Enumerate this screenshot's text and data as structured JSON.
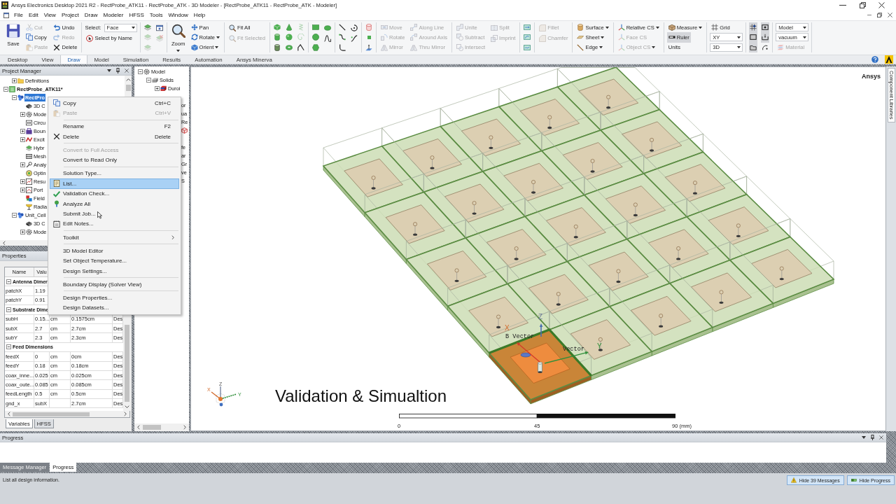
{
  "window": {
    "title": "Ansys Electronics Desktop 2021 R2 - RectProbe_ATK11 - RectProbe_ATK - 3D Modeler - [RectProbe_ATK11 - RectProbe_ATK - Modeler]"
  },
  "menu_bar": [
    "File",
    "Edit",
    "View",
    "Project",
    "Draw",
    "Modeler",
    "HFSS",
    "Tools",
    "Window",
    "Help"
  ],
  "ribbon": {
    "groups": [
      {
        "columns": [
          [
            {
              "kind": "save",
              "label": "Save",
              "disabled": false
            }
          ],
          [
            {
              "kind": "cut",
              "label": "Cut",
              "disabled": true
            },
            {
              "kind": "copy",
              "label": "Copy",
              "disabled": false
            },
            {
              "kind": "paste",
              "label": "Paste",
              "disabled": true
            }
          ],
          [
            {
              "kind": "undo",
              "label": "Undo",
              "disabled": false
            },
            {
              "kind": "redo",
              "label": "Redo",
              "disabled": true
            },
            {
              "kind": "delete",
              "label": "Delete",
              "disabled": false
            }
          ]
        ]
      },
      {
        "columns": [
          [
            {
              "kind": "select",
              "label": "Select:",
              "value": "Face"
            },
            {
              "kind": "select_by_name",
              "label": "Select by Name",
              "disabled": false
            }
          ]
        ]
      },
      {
        "columns": [
          [
            {
              "kind": "sheets",
              "disabled": false
            },
            {
              "kind": "sheets",
              "disabled": true
            },
            {
              "kind": "sheets",
              "disabled": true
            }
          ],
          [
            {
              "kind": "window",
              "disabled": false
            },
            {
              "kind": "sheetx",
              "disabled": true
            }
          ]
        ]
      },
      {
        "columns": [
          [
            {
              "kind": "zoom",
              "label": "Zoom",
              "disabled": false,
              "dropdown": true
            }
          ],
          [
            {
              "kind": "pan",
              "label": "Pan",
              "disabled": false
            },
            {
              "kind": "rotate",
              "label": "Rotate",
              "disabled": false,
              "dropdown": true
            },
            {
              "kind": "orient",
              "label": "Orient",
              "disabled": false,
              "dropdown": true
            }
          ]
        ]
      },
      {
        "columns": [
          [
            {
              "kind": "fit_all",
              "label": "Fit All",
              "disabled": false
            },
            {
              "kind": "fit_selected",
              "label": "Fit Selected",
              "disabled": true
            }
          ]
        ]
      },
      {
        "columns": [
          [
            {
              "kind": "box",
              "disabled": false
            },
            {
              "kind": "cylinder",
              "disabled": false
            },
            {
              "kind": "prism",
              "disabled": false
            }
          ],
          [
            {
              "kind": "cone",
              "disabled": false
            },
            {
              "kind": "sphere",
              "disabled": false
            },
            {
              "kind": "torus",
              "disabled": false
            }
          ],
          [
            {
              "kind": "helix",
              "disabled": true
            },
            {
              "kind": "spiral",
              "disabled": true
            },
            {
              "kind": "bondwire",
              "disabled": false
            }
          ]
        ]
      },
      {
        "columns": [
          [
            {
              "kind": "rectangle",
              "disabled": false
            },
            {
              "kind": "circle",
              "disabled": false
            },
            {
              "kind": "polygon",
              "disabled": false
            }
          ],
          [
            {
              "kind": "ellipse",
              "disabled": false
            },
            {
              "kind": "curved_sheet",
              "disabled": false
            }
          ]
        ]
      },
      {
        "columns": [
          [
            {
              "kind": "line",
              "disabled": false
            },
            {
              "kind": "spline",
              "disabled": false
            },
            {
              "kind": "arc",
              "disabled": false
            }
          ],
          [
            {
              "kind": "center_arc",
              "disabled": false
            },
            {
              "kind": "equation",
              "disabled": false
            }
          ]
        ]
      },
      {
        "columns": [
          [
            {
              "kind": "udp",
              "disabled": false
            },
            {
              "kind": "point",
              "disabled": false
            },
            {
              "kind": "plane",
              "disabled": false
            }
          ]
        ]
      },
      {
        "columns": [
          [
            {
              "kind": "move",
              "label": "Move",
              "disabled": true
            },
            {
              "kind": "rotate_copy",
              "label": "Rotate",
              "disabled": true
            },
            {
              "kind": "mirror",
              "label": "Mirror",
              "disabled": true
            }
          ],
          [
            {
              "kind": "along_line",
              "label": "Along Line",
              "disabled": true
            },
            {
              "kind": "around_axis",
              "label": "Around Axis",
              "disabled": true
            },
            {
              "kind": "thru_mirror",
              "label": "Thru Mirror",
              "disabled": true
            }
          ]
        ]
      },
      {
        "columns": [
          [
            {
              "kind": "unite",
              "label": "Unite",
              "disabled": true
            },
            {
              "kind": "subtract",
              "label": "Subtract",
              "disabled": true
            },
            {
              "kind": "intersect",
              "label": "Intersect",
              "disabled": true
            }
          ],
          [
            {
              "kind": "split",
              "label": "Split",
              "disabled": true
            },
            {
              "kind": "imprint",
              "label": "Imprint",
              "disabled": true
            }
          ]
        ]
      },
      {
        "columns": [
          [
            {
              "kind": "sweep_vector",
              "disabled": false
            },
            {
              "kind": "sweep_axis",
              "disabled": false
            },
            {
              "kind": "sweep_path",
              "disabled": false
            }
          ]
        ]
      },
      {
        "columns": [
          [
            {
              "kind": "fillet",
              "label": "Fillet",
              "disabled": true
            },
            {
              "kind": "chamfer",
              "label": "Chamfer",
              "disabled": true
            }
          ]
        ]
      },
      {
        "columns": [
          [
            {
              "kind": "surface",
              "label": "Surface",
              "disabled": false,
              "dropdown": true
            },
            {
              "kind": "sheet",
              "label": "Sheet",
              "disabled": false,
              "dropdown": true
            },
            {
              "kind": "edge",
              "label": "Edge",
              "disabled": false,
              "dropdown": true
            }
          ]
        ]
      },
      {
        "columns": [
          [
            {
              "kind": "relative_cs",
              "label": "Relative CS",
              "disabled": false,
              "dropdown": true
            },
            {
              "kind": "face_cs",
              "label": "Face CS",
              "disabled": true
            },
            {
              "kind": "object_cs",
              "label": "Object CS",
              "disabled": true,
              "dropdown": true
            }
          ]
        ]
      },
      {
        "columns": [
          [
            {
              "kind": "measure",
              "label": "Measure",
              "disabled": false,
              "dropdown": true,
              "pressed": false
            },
            {
              "kind": "ruler",
              "label": "Ruler",
              "disabled": false,
              "pressed": true
            },
            {
              "kind": "units",
              "label": "Units",
              "disabled": false,
              "pressed": false
            }
          ]
        ]
      },
      {
        "columns": [
          [
            {
              "kind": "grid",
              "label": "Grid",
              "disabled": false
            },
            {
              "kind": "select",
              "value": "XY"
            },
            {
              "kind": "select",
              "value": "3D"
            }
          ]
        ]
      },
      {
        "columns": [
          [
            {
              "kind": "snap_grid",
              "disabled": false,
              "pressed": true
            },
            {
              "kind": "snap_edge",
              "disabled": false,
              "pressed": true
            },
            {
              "kind": "snap_face",
              "disabled": false,
              "pressed": true
            }
          ],
          [
            {
              "kind": "snap_vertex",
              "disabled": false,
              "pressed": true
            },
            {
              "kind": "snap_center",
              "disabled": false,
              "pressed": true
            },
            {
              "kind": "snap_arc",
              "disabled": false,
              "pressed": false
            }
          ]
        ]
      },
      {
        "columns": [
          [
            {
              "kind": "select",
              "value": "Model"
            },
            {
              "kind": "select",
              "value": "vacuum"
            },
            {
              "kind": "material",
              "label": "Material",
              "disabled": true
            }
          ]
        ]
      }
    ]
  },
  "ribbon_tabs": [
    {
      "label": "Desktop",
      "selected": false
    },
    {
      "label": "View",
      "selected": false
    },
    {
      "label": "Draw",
      "selected": true
    },
    {
      "label": "Model",
      "selected": false
    },
    {
      "label": "Simulation",
      "selected": false
    },
    {
      "label": "Results",
      "selected": false
    },
    {
      "label": "Automation",
      "selected": false
    },
    {
      "label": "Ansys Minerva",
      "selected": false
    }
  ],
  "project_manager": {
    "title": "Project Manager",
    "continued_items": [
      {
        "kind": "folder",
        "label": "Definitions",
        "expanded": false,
        "selected": false
      }
    ],
    "tree": [
      {
        "kind": "project",
        "label": "RectProbe_ATK11*",
        "expanded": true,
        "selected": false,
        "children": [
          {
            "kind": "design",
            "label": "RectPro",
            "expanded": true,
            "selected": true,
            "children": [
              {
                "kind": "component",
                "label": "3D C",
                "selected": false
              },
              {
                "kind": "model",
                "label": "Mode",
                "expanded": false,
                "selected": false
              },
              {
                "kind": "circuit",
                "label": "Circu",
                "selected": false
              },
              {
                "kind": "boundary",
                "label": "Boun",
                "expanded": false,
                "selected": false
              },
              {
                "kind": "excitation",
                "label": "Excit",
                "expanded": false,
                "selected": false
              },
              {
                "kind": "hybrid",
                "label": "Hybr",
                "selected": false
              },
              {
                "kind": "mesh",
                "label": "Mesh",
                "selected": false
              },
              {
                "kind": "analysis",
                "label": "Analy",
                "expanded": false,
                "selected": false
              },
              {
                "kind": "optimetrics",
                "label": "Optin",
                "selected": false
              },
              {
                "kind": "results",
                "label": "Resu",
                "expanded": false,
                "selected": false
              },
              {
                "kind": "port",
                "label": "Port",
                "expanded": false,
                "selected": false
              },
              {
                "kind": "field",
                "label": "Field",
                "selected": false
              },
              {
                "kind": "radiation",
                "label": "Radia",
                "selected": false
              }
            ]
          },
          {
            "kind": "design",
            "label": "Unit_Cell",
            "expanded": true,
            "selected": false,
            "children": [
              {
                "kind": "component",
                "label": "3D C",
                "selected": false
              },
              {
                "kind": "model",
                "label": "Mode",
                "expanded": false,
                "selected": false
              }
            ]
          }
        ]
      }
    ]
  },
  "model_tree": {
    "items": [
      {
        "kind": "model",
        "label": "Model",
        "expanded": true,
        "selected": false,
        "children": [
          {
            "kind": "solids",
            "label": "Solids",
            "expanded": true,
            "selected": false,
            "children": [
              {
                "kind": "material",
                "label": "Duroi",
                "expanded": false,
                "selected": false
              }
            ]
          }
        ]
      }
    ],
    "partly_hidden_rows": [
      "or",
      "ua",
      "Re",
      "fe",
      "ar",
      "Gr",
      "ve",
      "S"
    ]
  },
  "context_menu": {
    "items": [
      {
        "kind": "copy",
        "label": "Copy",
        "shortcut": "Ctrl+C",
        "disabled": false,
        "selected": false
      },
      {
        "kind": "paste",
        "label": "Paste",
        "shortcut": "Ctrl+V",
        "disabled": true,
        "selected": false
      },
      {
        "kind": "separator"
      },
      {
        "kind": "plain",
        "label": "Rename",
        "shortcut": "F2",
        "disabled": false,
        "selected": false
      },
      {
        "kind": "delete",
        "label": "Delete",
        "shortcut": "Delete",
        "disabled": false,
        "selected": false
      },
      {
        "kind": "separator"
      },
      {
        "kind": "plain",
        "label": "Convert to Full Access",
        "disabled": true,
        "selected": false
      },
      {
        "kind": "plain",
        "label": "Convert to Read Only",
        "disabled": false,
        "selected": false
      },
      {
        "kind": "separator"
      },
      {
        "kind": "plain",
        "label": "Solution Type...",
        "disabled": false,
        "selected": false
      },
      {
        "kind": "list",
        "label": "List...",
        "disabled": false,
        "selected": true
      },
      {
        "kind": "validation",
        "label": "Validation Check...",
        "disabled": false,
        "selected": false
      },
      {
        "kind": "analyze",
        "label": "Analyze All",
        "disabled": false,
        "selected": false
      },
      {
        "kind": "plain",
        "label": "Submit Job...",
        "disabled": false,
        "selected": false,
        "pointer": true
      },
      {
        "kind": "edit_notes",
        "label": "Edit Notes...",
        "disabled": false,
        "selected": false
      },
      {
        "kind": "separator"
      },
      {
        "kind": "submenu",
        "label": "Toolkit",
        "disabled": false,
        "selected": false
      },
      {
        "kind": "separator"
      },
      {
        "kind": "plain",
        "label": "3D Model Editor",
        "disabled": false,
        "selected": false
      },
      {
        "kind": "plain",
        "label": "Set Object Temperature...",
        "disabled": false,
        "selected": false
      },
      {
        "kind": "plain",
        "label": "Design Settings...",
        "disabled": false,
        "selected": false
      },
      {
        "kind": "separator"
      },
      {
        "kind": "plain",
        "label": "Boundary Display (Solver View)",
        "disabled": false,
        "selected": false
      },
      {
        "kind": "separator"
      },
      {
        "kind": "plain",
        "label": "Design Properties...",
        "disabled": false,
        "selected": false
      },
      {
        "kind": "plain",
        "label": "Design Datasets...",
        "disabled": false,
        "selected": false
      }
    ]
  },
  "properties": {
    "title": "Properties",
    "columns": [
      "Name",
      "Valu"
    ],
    "rows": [
      {
        "kind": "section",
        "label": "Antenna Dimer",
        "expanded": true
      },
      {
        "kind": "variable",
        "name": "patchX",
        "value": "1.19"
      },
      {
        "kind": "variable",
        "name": "patchY",
        "value": "0.91"
      },
      {
        "kind": "section",
        "label": "Substrate Dime",
        "expanded": true
      },
      {
        "kind": "variable",
        "name": "subH",
        "value": "0.15...",
        "column_3": "cm",
        "column_4": "0.1575cm",
        "column_5": "Des"
      },
      {
        "kind": "variable",
        "name": "subX",
        "value": "2.7",
        "column_3": "cm",
        "column_4": "2.7cm",
        "column_5": "Des"
      },
      {
        "kind": "variable",
        "name": "subY",
        "value": "2.3",
        "column_3": "cm",
        "column_4": "2.3cm",
        "column_5": "Des"
      },
      {
        "kind": "section",
        "label": "Feed Dimensions",
        "expanded": true
      },
      {
        "kind": "variable",
        "name": "feedX",
        "value": "0",
        "column_3": "cm",
        "column_4": "0cm",
        "column_5": "Des"
      },
      {
        "kind": "variable",
        "name": "feedY",
        "value": "0.18",
        "column_3": "cm",
        "column_4": "0.18cm",
        "column_5": "Des"
      },
      {
        "kind": "variable",
        "name": "coax_inne...",
        "value": "0.025",
        "column_3": "cm",
        "column_4": "0.025cm",
        "column_5": "Des"
      },
      {
        "kind": "variable",
        "name": "coax_oute...",
        "value": "0.085",
        "column_3": "cm",
        "column_4": "0.085cm",
        "column_5": "Des"
      },
      {
        "kind": "variable",
        "name": "feedLength",
        "value": "0.5",
        "column_3": "cm",
        "column_4": "0.5cm",
        "column_5": "Des"
      },
      {
        "kind": "variable",
        "name": "gnd_x",
        "value": "subX",
        "column_4": "2.7cm",
        "column_5": "Des"
      }
    ],
    "tabs": [
      {
        "label": "Variables",
        "selected": true
      },
      {
        "label": "HFSS",
        "selected": false
      }
    ]
  },
  "viewport": {
    "brand": "Ansys",
    "axis_labels": {
      "x": "X",
      "y": "Y",
      "z": "Z"
    },
    "vector_labels": [
      "B Vector",
      "Vector"
    ],
    "triad_labels": {
      "x": "X",
      "y": "Y",
      "z": "Z"
    },
    "caption": "Validation & Simualtion",
    "scale_labels": [
      "0",
      "45",
      "90 (mm)"
    ]
  },
  "side_tab": "Component Libraries",
  "progress_panel": {
    "title": "Progress"
  },
  "bottom_tabs": [
    {
      "label": "Message Manager",
      "selected": false
    },
    {
      "label": "Progress",
      "selected": true
    }
  ],
  "status_bar": {
    "text": "List all design information.",
    "buttons": [
      {
        "kind": "warning",
        "label": "Hide 39 Messages"
      },
      {
        "kind": "progress",
        "label": "Hide Progress"
      }
    ]
  }
}
